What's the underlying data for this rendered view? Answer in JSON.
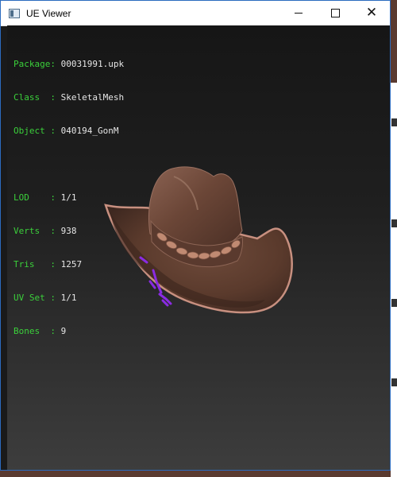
{
  "window": {
    "title": "UE Viewer",
    "controls": {
      "minimize": "minimize-icon",
      "maximize": "maximize-icon",
      "close": "close-icon"
    }
  },
  "info": {
    "package": {
      "key": "Package: ",
      "value": "00031991.upk"
    },
    "class": {
      "key": "Class  : ",
      "value": "SkeletalMesh"
    },
    "object": {
      "key": "Object : ",
      "value": "040194_GonM"
    },
    "lod": {
      "key": "LOD    : ",
      "value": "1/1"
    },
    "verts": {
      "key": "Verts  : ",
      "value": "938"
    },
    "tris": {
      "key": "Tris   : ",
      "value": "1257"
    },
    "uvset": {
      "key": "UV Set : ",
      "value": "1/1"
    },
    "bones": {
      "key": "Bones  : ",
      "value": "9"
    }
  },
  "colors": {
    "label_green": "#3bd03b",
    "value_white": "#e6e6e6",
    "viewport_top": "#161616",
    "viewport_bottom": "#3d3d3d"
  }
}
